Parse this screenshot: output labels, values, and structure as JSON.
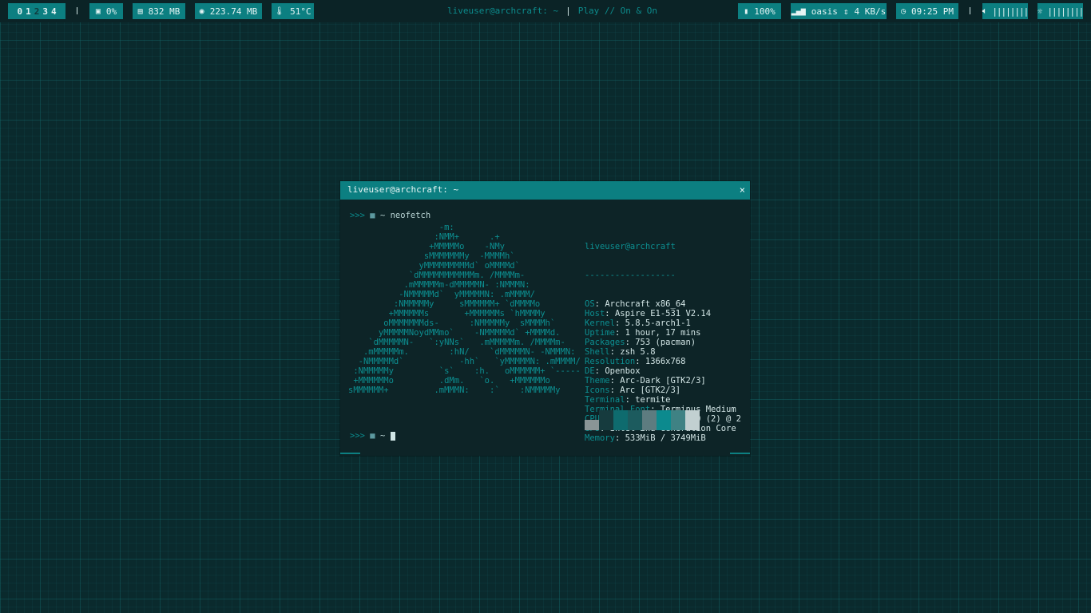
{
  "topbar": {
    "workspaces": [
      {
        "label": "0",
        "active": true
      },
      {
        "label": "1",
        "active": true
      },
      {
        "label": "2",
        "active": false
      },
      {
        "label": "3",
        "active": true
      },
      {
        "label": "4",
        "active": true
      }
    ],
    "cpu": {
      "icon": "cpu-icon",
      "value": "0%"
    },
    "memory": {
      "icon": "memory-icon",
      "value": "832 MB"
    },
    "disk": {
      "icon": "disk-icon",
      "value": "223.74 MB"
    },
    "temperature": {
      "icon": "thermometer-icon",
      "value": "51°C"
    },
    "window_title": "liveuser@archcraft: ~",
    "player": "Play // On & On",
    "battery": {
      "icon": "battery-icon",
      "value": "100%"
    },
    "network": {
      "icon": "signal-icon",
      "ssid": "oasis",
      "speed": "4 KB/s"
    },
    "clock": {
      "icon": "clock-icon",
      "value": "09:25 PM"
    },
    "volume": {
      "icon": "speaker-icon",
      "bars": "||||||||"
    },
    "brightness": {
      "icon": "brightness-icon",
      "bars": "||||||||"
    }
  },
  "terminal": {
    "title": "liveuser@archcraft: ~",
    "close_glyph": "×",
    "prompt_arrows": ">>>",
    "prompt_dir": "~",
    "command": "neofetch",
    "ascii_art": "                  -m:\n                 :NMM+      .+\n                +MMMMMo    -NMy\n               sMMMMMMMy  -MMMMh`\n              yMMMMMMMMMd` oMMMMd`\n            `dMMMMMMMMMMMm. /MMMMm-\n           .mMMMMMm-dMMMMMN- :NMMMN:\n          -NMMMMMd`  yMMMMMN: .mMMMM/\n         :NMMMMMy     sMMMMMM+ `dMMMMo\n        +MMMMMMs       +MMMMMMs `hMMMMy\n       oMMMMMMMds-      :NMMMMMy  sMMMMh`\n      yMMMMMNoydMMmo`    -NMMMMMd` +MMMMd.\n    `dMMMMMN-   `:yNNs`   .mMMMMMm. /MMMMm-\n   .mMMMMMm.        :hN/    `dMMMMMN- -NMMMN:\n  -NMMMMMd`           -hh`   `yMMMMMN: .mMMMM/\n :NMMMMMy         `s`    :h.   oMMMMMM+ `-----\n +MMMMMMo         .dMm.   `o.   +MMMMMMo\nsMMMMMM+         .mMMMN:    :`    :NMMMMMy",
    "info": {
      "userhost": "liveuser@archcraft",
      "separator": "------------------",
      "rows": [
        {
          "key": "OS",
          "value": "Archcraft x86_64"
        },
        {
          "key": "Host",
          "value": "Aspire E1-531 V2.14"
        },
        {
          "key": "Kernel",
          "value": "5.8.5-arch1-1"
        },
        {
          "key": "Uptime",
          "value": "1 hour, 17 mins"
        },
        {
          "key": "Packages",
          "value": "753 (pacman)"
        },
        {
          "key": "Shell",
          "value": "zsh 5.8"
        },
        {
          "key": "Resolution",
          "value": "1366x768"
        },
        {
          "key": "DE",
          "value": "Openbox"
        },
        {
          "key": "Theme",
          "value": "Arc-Dark [GTK2/3]"
        },
        {
          "key": "Icons",
          "value": "Arc [GTK2/3]"
        },
        {
          "key": "Terminal",
          "value": "termite"
        },
        {
          "key": "Terminal Font",
          "value": "Terminus Medium"
        },
        {
          "key": "CPU",
          "value": "Intel Pentium B960 (2) @ 2"
        },
        {
          "key": "GPU",
          "value": "Intel 2nd Generation Core"
        },
        {
          "key": "Memory",
          "value": "533MiB / 3749MiB"
        }
      ]
    },
    "palette": [
      "#8a9596",
      "#163b3e",
      "#0e6b6e",
      "#1c5b5e",
      "#5d7c80",
      "#0c8a8e",
      "#3f8284",
      "#c2d0d1"
    ]
  }
}
